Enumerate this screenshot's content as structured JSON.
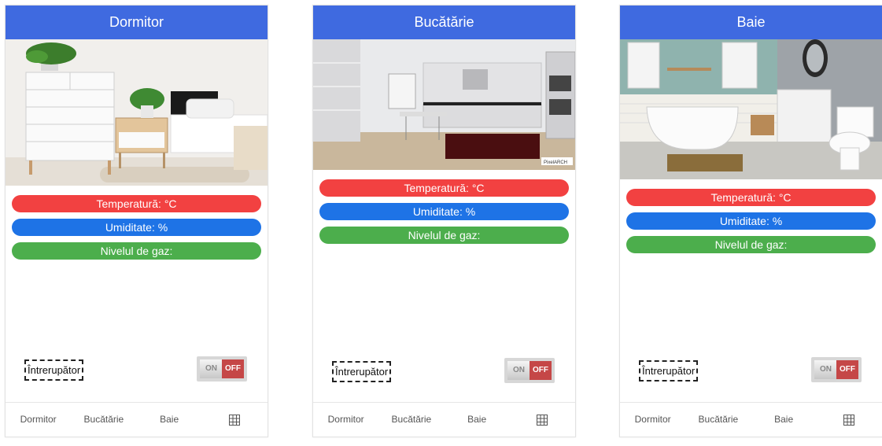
{
  "colors": {
    "title_bar": "#3f6ae0",
    "temperature": "#f24141",
    "humidity": "#1e73e6",
    "gas": "#4cae4c",
    "switch_off": "#c54747"
  },
  "panels": [
    {
      "title": "Dormitor",
      "temperature": "Temperatură: °C",
      "humidity": "Umiditate: %",
      "gas": "Nivelul de gaz:",
      "switch_label": "Întrerupător",
      "switch_on": "ON",
      "switch_off": "OFF",
      "nav": [
        "Dormitor",
        "Bucătărie",
        "Baie"
      ],
      "nav_icon": "grid-icon"
    },
    {
      "title": "Bucătărie",
      "temperature": "Temperatură: °C",
      "humidity": "Umiditate: %",
      "gas": "Nivelul de gaz:",
      "switch_label": "Întrerupător",
      "switch_on": "ON",
      "switch_off": "OFF",
      "photo_watermark": "PixelARCH",
      "nav": [
        "Dormitor",
        "Bucătărie",
        "Baie"
      ],
      "nav_icon": "grid-icon"
    },
    {
      "title": "Baie",
      "temperature": "Temperatură: °C",
      "humidity": "Umiditate: %",
      "gas": "Nivelul de gaz:",
      "switch_label": "Întrerupător",
      "switch_on": "ON",
      "switch_off": "OFF",
      "nav": [
        "Dormitor",
        "Bucătărie",
        "Baie"
      ],
      "nav_icon": "grid-icon"
    }
  ]
}
